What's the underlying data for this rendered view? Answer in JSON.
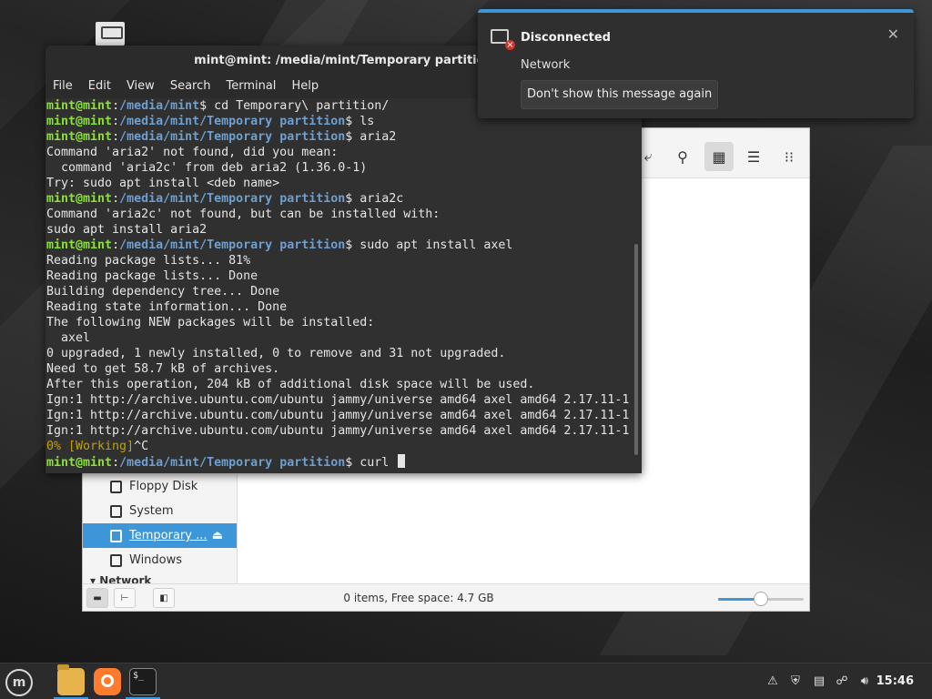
{
  "terminal": {
    "title": "mint@mint: /media/mint/Temporary partition",
    "menu": [
      "File",
      "Edit",
      "View",
      "Search",
      "Terminal",
      "Help"
    ],
    "lines": [
      {
        "type": "prompt",
        "user": "mint@mint",
        "path": "/media/mint",
        "cmd": "cd Temporary\\ partition/"
      },
      {
        "type": "prompt",
        "user": "mint@mint",
        "path": "/media/mint/Temporary partition",
        "cmd": "ls"
      },
      {
        "type": "prompt",
        "user": "mint@mint",
        "path": "/media/mint/Temporary partition",
        "cmd": "aria2"
      },
      {
        "type": "out",
        "text": "Command 'aria2' not found, did you mean:"
      },
      {
        "type": "out",
        "text": "  command 'aria2c' from deb aria2 (1.36.0-1)"
      },
      {
        "type": "out",
        "text": "Try: sudo apt install <deb name>"
      },
      {
        "type": "prompt",
        "user": "mint@mint",
        "path": "/media/mint/Temporary partition",
        "cmd": "aria2c"
      },
      {
        "type": "out",
        "text": "Command 'aria2c' not found, but can be installed with:"
      },
      {
        "type": "out",
        "text": "sudo apt install aria2"
      },
      {
        "type": "prompt",
        "user": "mint@mint",
        "path": "/media/mint/Temporary partition",
        "cmd": "sudo apt install axel"
      },
      {
        "type": "out",
        "text": "Reading package lists... 81%"
      },
      {
        "type": "out",
        "text": "Reading package lists... Done"
      },
      {
        "type": "out",
        "text": "Building dependency tree... Done"
      },
      {
        "type": "out",
        "text": "Reading state information... Done"
      },
      {
        "type": "out",
        "text": "The following NEW packages will be installed:"
      },
      {
        "type": "out",
        "text": "  axel"
      },
      {
        "type": "out",
        "text": "0 upgraded, 1 newly installed, 0 to remove and 31 not upgraded."
      },
      {
        "type": "out",
        "text": "Need to get 58.7 kB of archives."
      },
      {
        "type": "out",
        "text": "After this operation, 204 kB of additional disk space will be used."
      },
      {
        "type": "out",
        "text": "Ign:1 http://archive.ubuntu.com/ubuntu jammy/universe amd64 axel amd64 2.17.11-1"
      },
      {
        "type": "out",
        "text": "Ign:1 http://archive.ubuntu.com/ubuntu jammy/universe amd64 axel amd64 2.17.11-1"
      },
      {
        "type": "out",
        "text": "Ign:1 http://archive.ubuntu.com/ubuntu jammy/universe amd64 axel amd64 2.17.11-1"
      },
      {
        "type": "warn",
        "text": "0% [Working]",
        "suffix": "^C"
      },
      {
        "type": "prompt",
        "user": "mint@mint",
        "path": "/media/mint/Temporary partition",
        "cmd": "curl ",
        "cursor": true
      }
    ]
  },
  "notification": {
    "title": "Disconnected",
    "body": "Network",
    "button": "Don't show this message again",
    "icon": "network-disconnected-icon"
  },
  "file_manager": {
    "sidebar": [
      {
        "label": "Floppy Disk",
        "selected": false
      },
      {
        "label": "System",
        "selected": false
      },
      {
        "label": "Temporary ...",
        "selected": true,
        "eject": true
      },
      {
        "label": "Windows",
        "selected": false
      }
    ],
    "network_header": "Network",
    "status_text": "0 items, Free space: 4.7 GB",
    "zoom_level": 0.5,
    "accent": "#3d96d8"
  },
  "taskbar": {
    "clock": "15:46",
    "apps": [
      "file-manager",
      "firefox",
      "terminal"
    ],
    "terminal_icon_text": "$_"
  }
}
